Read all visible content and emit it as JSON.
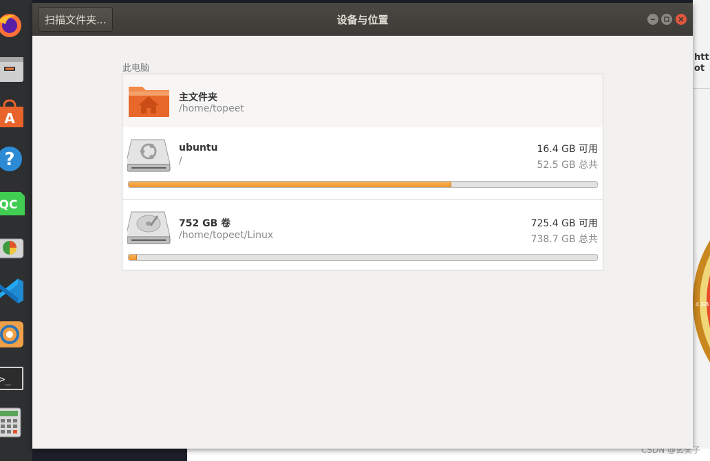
{
  "window": {
    "title": "设备与位置",
    "scan_button_label": "扫描文件夹..."
  },
  "section": {
    "label": "此电脑"
  },
  "locations": [
    {
      "name": "主文件夹",
      "path": "/home/topeet",
      "icon": "home-folder-icon"
    },
    {
      "name": "ubuntu",
      "path": "/",
      "free": "16.4 GB 可用",
      "total": "52.5 GB 总共",
      "usage_fraction": 0.688,
      "icon": "ubuntu-drive-icon"
    },
    {
      "name": "752 GB 卷",
      "path": "/home/topeet/Linux",
      "free": "725.4 GB 可用",
      "total": "738.7 GB 总共",
      "usage_fraction": 0.018,
      "icon": "hard-disk-icon"
    }
  ],
  "background": {
    "right_text_line1": "htt",
    "right_text_line2": "ot",
    "chart_label": "4 GB",
    "watermark": "CSDN @玄奘子"
  },
  "colors": {
    "accent_orange": "#f0952b",
    "close_red": "#e2573c",
    "titlebar": "#3c3b37"
  }
}
